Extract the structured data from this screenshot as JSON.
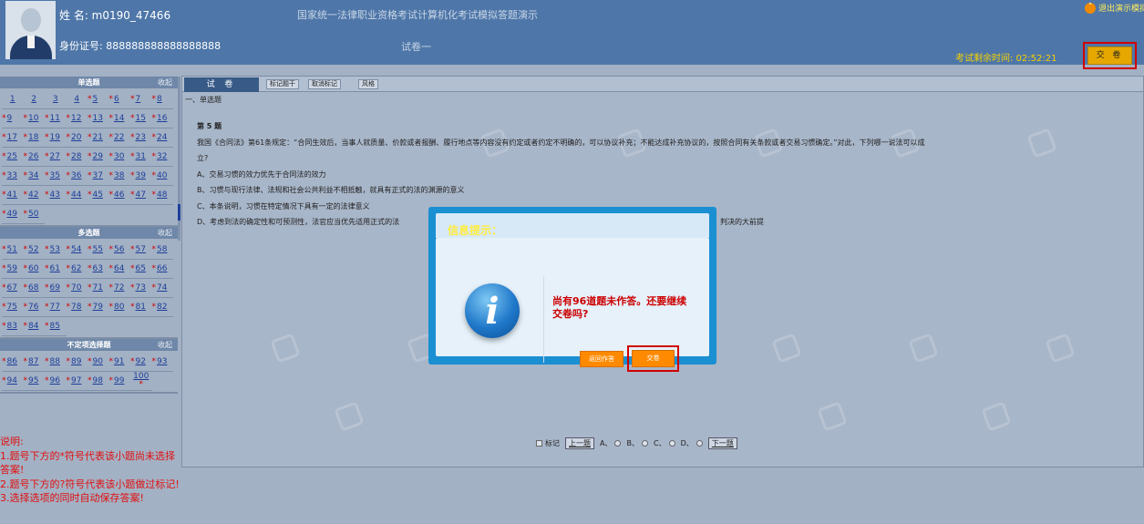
{
  "header": {
    "name_label": "姓 名: m0190_47466",
    "id_label": "身份证号: 888888888888888888",
    "title": "国家统一法律职业资格考试计算机化考试模拟答题演示",
    "paper": "试卷一",
    "timer": "考试剩余时间: 02:52:21",
    "submit_label": "交 卷",
    "exit_label": "退出演示模拟",
    "colors": {
      "header_bg": "#4e76a8",
      "timer": "#f5d000",
      "highlight": "#d00000"
    }
  },
  "sidebar": {
    "sections": [
      {
        "title": "单选题",
        "collapse": "收起",
        "questions": [
          "1",
          "2",
          "3",
          "4",
          "5",
          "6",
          "7",
          "8",
          "9",
          "10",
          "11",
          "12",
          "13",
          "14",
          "15",
          "16",
          "17",
          "18",
          "19",
          "20",
          "21",
          "22",
          "23",
          "24",
          "25",
          "26",
          "27",
          "28",
          "29",
          "30",
          "31",
          "32",
          "33",
          "34",
          "35",
          "36",
          "37",
          "38",
          "39",
          "40",
          "41",
          "42",
          "43",
          "44",
          "45",
          "46",
          "47",
          "48",
          "49",
          "50"
        ]
      },
      {
        "title": "多选题",
        "collapse": "收起",
        "questions": [
          "51",
          "52",
          "53",
          "54",
          "55",
          "56",
          "57",
          "58",
          "59",
          "60",
          "61",
          "62",
          "63",
          "64",
          "65",
          "66",
          "67",
          "68",
          "69",
          "70",
          "71",
          "72",
          "73",
          "74",
          "75",
          "76",
          "77",
          "78",
          "79",
          "80",
          "81",
          "82",
          "83",
          "84",
          "85"
        ]
      },
      {
        "title": "不定项选择题",
        "collapse": "收起",
        "questions": [
          "86",
          "87",
          "88",
          "89",
          "90",
          "91",
          "92",
          "93",
          "94",
          "95",
          "96",
          "97",
          "98",
          "99",
          "100"
        ]
      }
    ],
    "unanswered_mark": "*",
    "notes": [
      "说明:",
      "1.题号下方的*符号代表该小题尚未选择答案!",
      "2.题号下方的?符号代表该小题做过标记!",
      "3.选择选项的同时自动保存答案!"
    ]
  },
  "main": {
    "tab_label": "试 卷",
    "toolbar": [
      "标记题干",
      "取消标记",
      "风格"
    ],
    "question_type": "一、单选题",
    "question_no": "第 5 题",
    "stem_line1": "我国《合同法》第61条规定：“合同生效后，当事人就质量、价款或者报酬、履行地点等内容没有约定或者约定不明确的，可以协议补充；不能达成补充协议的，按照合同有关条款或者交易习惯确定。”对此，下列哪一说法可以成",
    "stem_line2": "立?",
    "options": [
      "A、交易习惯的效力优先于合同法的效力",
      "B、习惯与现行法律、法规和社会公共利益不相抵触，就具有正式的法的渊源的意义",
      "C、本条说明，习惯在特定情况下具有一定的法律意义",
      "D、考虑到法的确定性和可预测性，法官应当优先适用正式的法"
    ],
    "option_d_tail": "判决的大前提",
    "answer_bar": {
      "mark_label": "标记",
      "prev_label": "上一题",
      "next_label": "下一题",
      "choices": [
        "A、",
        "B、",
        "C、",
        "D、"
      ]
    }
  },
  "modal": {
    "title": "信息提示：",
    "message": "尚有96道题未作答。还要继续交卷吗?",
    "back_label": "返回作答",
    "confirm_label": "交卷",
    "icon": "info-icon"
  }
}
